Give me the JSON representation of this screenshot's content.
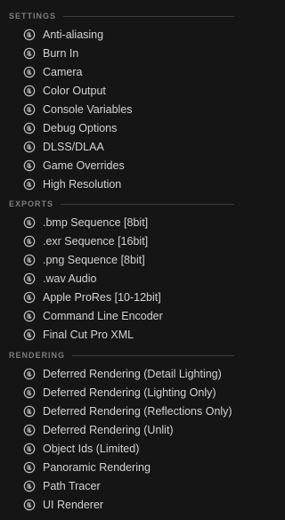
{
  "settings": {
    "title": "SETTINGS",
    "items": [
      {
        "label": "Anti-aliasing",
        "icon": "unreal-logo-icon"
      },
      {
        "label": "Burn In",
        "icon": "unreal-logo-icon"
      },
      {
        "label": "Camera",
        "icon": "unreal-logo-icon"
      },
      {
        "label": "Color Output",
        "icon": "unreal-logo-icon"
      },
      {
        "label": "Console Variables",
        "icon": "unreal-logo-icon"
      },
      {
        "label": "Debug Options",
        "icon": "unreal-logo-icon"
      },
      {
        "label": "DLSS/DLAA",
        "icon": "unreal-logo-icon"
      },
      {
        "label": "Game Overrides",
        "icon": "unreal-logo-icon"
      },
      {
        "label": "High Resolution",
        "icon": "unreal-logo-icon"
      }
    ]
  },
  "exports": {
    "title": "EXPORTS",
    "items": [
      {
        "label": ".bmp Sequence [8bit]",
        "icon": "unreal-logo-icon"
      },
      {
        "label": ".exr Sequence [16bit]",
        "icon": "unreal-logo-icon"
      },
      {
        "label": ".png Sequence [8bit]",
        "icon": "unreal-logo-icon"
      },
      {
        "label": ".wav Audio",
        "icon": "unreal-logo-icon"
      },
      {
        "label": "Apple ProRes [10-12bit]",
        "icon": "unreal-logo-icon"
      },
      {
        "label": "Command Line Encoder",
        "icon": "unreal-logo-icon"
      },
      {
        "label": "Final Cut Pro XML",
        "icon": "unreal-logo-icon"
      }
    ]
  },
  "rendering": {
    "title": "RENDERING",
    "items": [
      {
        "label": "Deferred Rendering (Detail Lighting)",
        "icon": "unreal-logo-icon"
      },
      {
        "label": "Deferred Rendering (Lighting Only)",
        "icon": "unreal-logo-icon"
      },
      {
        "label": "Deferred Rendering (Reflections Only)",
        "icon": "unreal-logo-icon"
      },
      {
        "label": "Deferred Rendering (Unlit)",
        "icon": "unreal-logo-icon"
      },
      {
        "label": "Object Ids (Limited)",
        "icon": "unreal-logo-icon"
      },
      {
        "label": "Panoramic Rendering",
        "icon": "unreal-logo-icon"
      },
      {
        "label": "Path Tracer",
        "icon": "unreal-logo-icon"
      },
      {
        "label": "UI Renderer",
        "icon": "unreal-logo-icon"
      }
    ]
  },
  "colors": {
    "background": "#151515",
    "header_text": "#7d7d7d",
    "item_text": "#d3d3d3",
    "separator": "#3c3c3c",
    "icon": "#bdbdbd"
  }
}
